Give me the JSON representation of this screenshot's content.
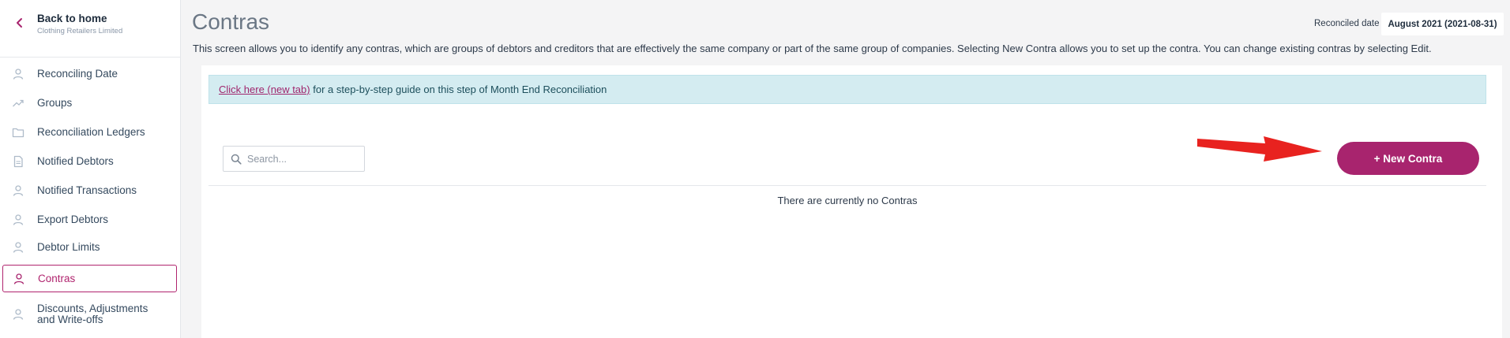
{
  "sidebar": {
    "back_title": "Back to home",
    "back_subtitle": "Clothing Retailers Limited",
    "items": [
      {
        "label": "Reconciling Date",
        "icon": "user-icon"
      },
      {
        "label": "Groups",
        "icon": "trending-icon"
      },
      {
        "label": "Reconciliation Ledgers",
        "icon": "folder-icon"
      },
      {
        "label": "Notified Debtors",
        "icon": "document-icon"
      },
      {
        "label": "Notified Transactions",
        "icon": "user-icon"
      },
      {
        "label": "Export Debtors",
        "icon": "user-icon"
      },
      {
        "label": "Debtor Limits",
        "icon": "user-icon"
      },
      {
        "label": "Contras",
        "icon": "user-icon",
        "active": true
      },
      {
        "label": "Discounts, Adjustments and Write-offs",
        "icon": "user-icon"
      }
    ]
  },
  "header": {
    "title": "Contras",
    "reconciled_label": "Reconciled date",
    "reconciled_value": "August 2021 (2021-08-31)",
    "description": "This screen allows you to identify any contras, which are groups of debtors and creditors that are effectively the same company or part of the same group of companies. Selecting New Contra allows you to set up the contra. You can change existing contras by selecting Edit."
  },
  "info": {
    "link_text": "Click here (new tab)",
    "text": " for a step-by-step guide on this step of Month End Reconciliation"
  },
  "search": {
    "placeholder": "Search...",
    "value": ""
  },
  "actions": {
    "new_contra_label": "+ New Contra"
  },
  "empty_state": "There are currently no Contras",
  "colors": {
    "accent": "#a8246e",
    "info_bg": "#d4ecf1",
    "arrow": "#e8221f"
  }
}
